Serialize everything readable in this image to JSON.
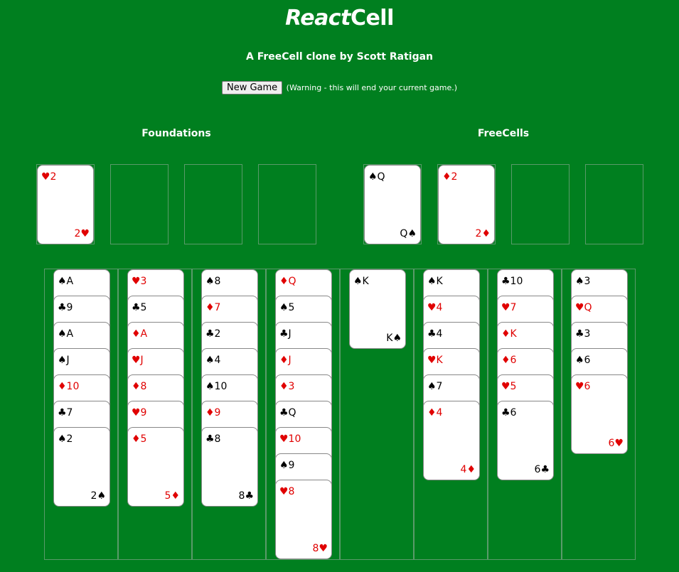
{
  "header": {
    "title_italic": "React",
    "title_rest": "Cell",
    "subtitle": "A FreeCell clone by Scott Ratigan",
    "new_game_label": "New Game",
    "warning": "(Warning - this will end your current game.)"
  },
  "foundations": {
    "heading": "Foundations",
    "slots": [
      {
        "label": "♥2",
        "corner": "2♥",
        "color": "red"
      },
      null,
      null,
      null
    ]
  },
  "freecells": {
    "heading": "FreeCells",
    "slots": [
      {
        "label": "♠Q",
        "corner": "Q♠",
        "color": "black"
      },
      {
        "label": "♦2",
        "corner": "2♦",
        "color": "red"
      },
      null,
      null
    ]
  },
  "tableau": [
    [
      {
        "label": "♠A",
        "color": "black"
      },
      {
        "label": "♣9",
        "color": "black"
      },
      {
        "label": "♠A",
        "color": "black"
      },
      {
        "label": "♠J",
        "color": "black"
      },
      {
        "label": "♦10",
        "color": "red"
      },
      {
        "label": "♣7",
        "color": "black"
      },
      {
        "label": "♠2",
        "corner": "2♠",
        "color": "black"
      }
    ],
    [
      {
        "label": "♥3",
        "color": "red"
      },
      {
        "label": "♣5",
        "color": "black"
      },
      {
        "label": "♦A",
        "color": "red"
      },
      {
        "label": "♥J",
        "color": "red"
      },
      {
        "label": "♦8",
        "color": "red"
      },
      {
        "label": "♥9",
        "color": "red"
      },
      {
        "label": "♦5",
        "corner": "5♦",
        "color": "red"
      }
    ],
    [
      {
        "label": "♠8",
        "color": "black"
      },
      {
        "label": "♦7",
        "color": "red"
      },
      {
        "label": "♣2",
        "color": "black"
      },
      {
        "label": "♠4",
        "color": "black"
      },
      {
        "label": "♠10",
        "color": "black"
      },
      {
        "label": "♦9",
        "color": "red"
      },
      {
        "label": "♣8",
        "corner": "8♣",
        "color": "black"
      }
    ],
    [
      {
        "label": "♦Q",
        "color": "red"
      },
      {
        "label": "♠5",
        "color": "black"
      },
      {
        "label": "♣J",
        "color": "black"
      },
      {
        "label": "♦J",
        "color": "red"
      },
      {
        "label": "♦3",
        "color": "red"
      },
      {
        "label": "♣Q",
        "color": "black"
      },
      {
        "label": "♥10",
        "color": "red"
      },
      {
        "label": "♠9",
        "color": "black"
      },
      {
        "label": "♥8",
        "corner": "8♥",
        "color": "red"
      }
    ],
    [
      {
        "label": "♠K",
        "corner": "K♠",
        "color": "black"
      }
    ],
    [
      {
        "label": "♠K",
        "color": "black"
      },
      {
        "label": "♥4",
        "color": "red"
      },
      {
        "label": "♣4",
        "color": "black"
      },
      {
        "label": "♥K",
        "color": "red"
      },
      {
        "label": "♠7",
        "color": "black"
      },
      {
        "label": "♦4",
        "corner": "4♦",
        "color": "red"
      }
    ],
    [
      {
        "label": "♣10",
        "color": "black"
      },
      {
        "label": "♥7",
        "color": "red"
      },
      {
        "label": "♦K",
        "color": "red"
      },
      {
        "label": "♦6",
        "color": "red"
      },
      {
        "label": "♥5",
        "color": "red"
      },
      {
        "label": "♣6",
        "corner": "6♣",
        "color": "black"
      }
    ],
    [
      {
        "label": "♠3",
        "color": "black"
      },
      {
        "label": "♥Q",
        "color": "red"
      },
      {
        "label": "♣3",
        "color": "black"
      },
      {
        "label": "♠6",
        "color": "black"
      },
      {
        "label": "♥6",
        "corner": "6♥",
        "color": "red"
      }
    ]
  ],
  "colors": {
    "table_green": "#007f1f",
    "card_red": "#e00000",
    "card_black": "#000000"
  }
}
